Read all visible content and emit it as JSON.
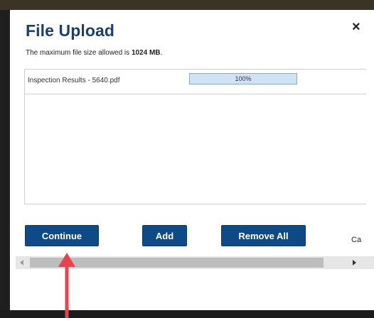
{
  "dialog": {
    "title": "File Upload",
    "close_label": "×",
    "size_note_prefix": "The maximum file size allowed is ",
    "size_note_value": "1024 MB",
    "size_note_suffix": "."
  },
  "files": [
    {
      "name": "Inspection Results - 5640.pdf",
      "progress": 100,
      "progress_label": "100%"
    }
  ],
  "buttons": {
    "continue": "Continue",
    "add": "Add",
    "remove_all": "Remove All",
    "cancel": "Ca"
  },
  "colors": {
    "title": "#1b3f75",
    "button": "#0e4a86",
    "annotation_arrow": "#e8434e"
  },
  "icons": {
    "close": "close-icon",
    "scroll_left": "arrow-left-icon",
    "scroll_right": "arrow-right-icon"
  }
}
